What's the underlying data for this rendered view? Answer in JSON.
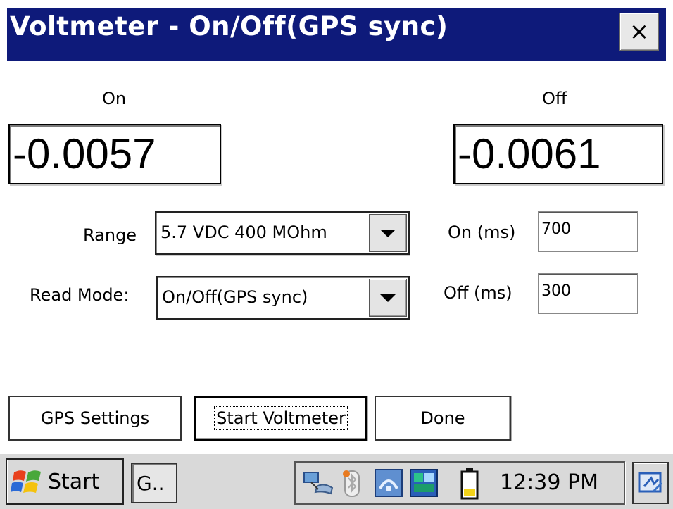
{
  "window": {
    "title": "Voltmeter - On/Off(GPS sync)",
    "close_glyph": "×"
  },
  "readings": {
    "on_label": "On",
    "off_label": "Off",
    "on_value": "-0.0057",
    "off_value": "-0.0061"
  },
  "range": {
    "label": "Range",
    "value": "5.7 VDC 400 MOhm"
  },
  "read_mode": {
    "label": "Read Mode:",
    "value": "On/Off(GPS sync)"
  },
  "timing": {
    "on_label": "On (ms)",
    "on_value": "700",
    "off_label": "Off (ms)",
    "off_value": "300"
  },
  "buttons": {
    "gps_settings": "GPS Settings",
    "start_voltmeter": "Start Voltmeter",
    "done": "Done"
  },
  "taskbar": {
    "start_label": "Start",
    "task_item": "G..",
    "clock": "12:39 PM",
    "tray_icons": [
      "network-icon",
      "bluetooth-icon",
      "wireless-manager-icon",
      "gps-client-icon",
      "battery-icon"
    ]
  },
  "colors": {
    "title_bar": "#0e1a7a",
    "taskbar": "#d9d9d9"
  }
}
